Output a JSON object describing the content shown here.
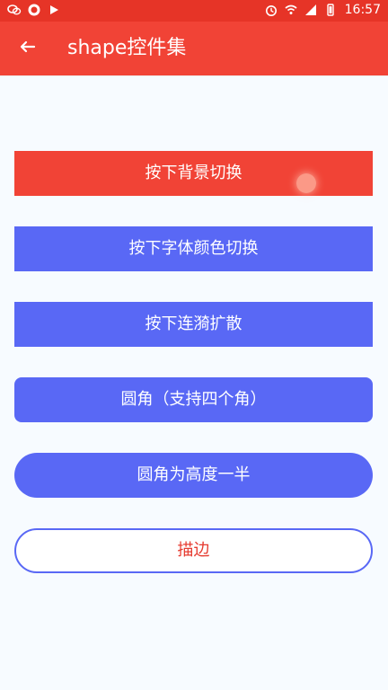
{
  "status_bar": {
    "time": "16:57",
    "icons": {
      "left": [
        "wechat-icon",
        "nfc-icon",
        "play-icon"
      ],
      "right": [
        "alarm-icon",
        "wifi-icon",
        "signal-icon",
        "battery-icon"
      ]
    },
    "background": "#e63427"
  },
  "toolbar": {
    "title": "shape控件集",
    "background": "#f14336",
    "back_icon": "arrow-back-icon"
  },
  "buttons": [
    {
      "label": "按下背景切换",
      "style": "red",
      "color": "#f14336"
    },
    {
      "label": "按下字体颜色切换",
      "style": "blue",
      "color": "#5968f5"
    },
    {
      "label": "按下连漪扩散",
      "style": "blue",
      "color": "#5968f5"
    },
    {
      "label": "圆角（支持四个角）",
      "style": "rounded",
      "color": "#5968f5"
    },
    {
      "label": "圆角为高度一半",
      "style": "pill",
      "color": "#5968f5"
    },
    {
      "label": "描边",
      "style": "outline",
      "color": "#e63b30"
    }
  ]
}
